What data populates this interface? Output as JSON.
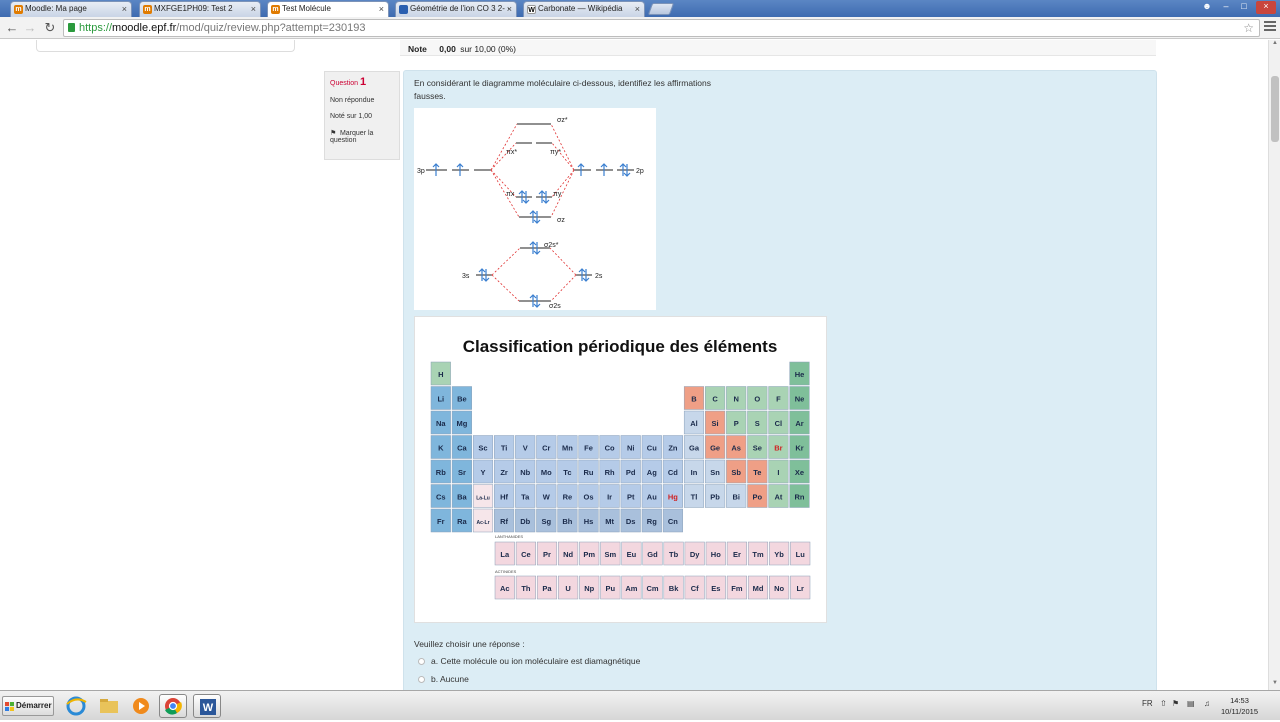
{
  "browser": {
    "tabs": [
      {
        "title": "Moodle: Ma page",
        "active": false
      },
      {
        "title": "MXFGE1PH09: Test 2",
        "active": false
      },
      {
        "title": "Test Molécule",
        "active": true
      },
      {
        "title": "Géométrie de l'ion CO 3 2- ·",
        "active": false
      },
      {
        "title": "Carbonate — Wikipédia",
        "active": false
      }
    ],
    "url": {
      "protocol": "https://",
      "host": "moodle.epf.fr",
      "path": "/mod/quiz/review.php?attempt=230193"
    }
  },
  "grade": {
    "label": "Note",
    "value": "0,00",
    "sur": "sur",
    "max": "10,00",
    "percent": "(0%)"
  },
  "question_info": {
    "label": "Question",
    "number": "1",
    "status": "Non répondue",
    "marks": "Noté sur 1,00",
    "flag_label": "Marquer la question"
  },
  "question": {
    "text": "En considérant le diagramme moléculaire ci-dessous, identifiez les affirmations fausses.",
    "choose_label": "Veuillez choisir une réponse :",
    "answers": [
      {
        "label": "a. Cette molécule ou ion moléculaire est diamagnétique"
      },
      {
        "label": "b. Aucune"
      }
    ]
  },
  "mo_diagram": {
    "left_top": "3p",
    "right_top": "2p",
    "left_bottom": "3s",
    "right_bottom": "2s",
    "sigma_z_star": "σz*",
    "pi_x_star": "πx*",
    "pi_y_star": "πy*",
    "pi_x": "πx",
    "pi_y": "πy",
    "sigma_z": "σz",
    "sigma_2s_star": "σ2s*",
    "sigma_2s": "σ2s"
  },
  "periodic_table": {
    "title": "Classification périodique des éléments",
    "rows": [
      [
        "H",
        "",
        "",
        "",
        "",
        "",
        "",
        "",
        "",
        "",
        "",
        "",
        "",
        "",
        "",
        "",
        "",
        "He"
      ],
      [
        "Li",
        "Be",
        "",
        "",
        "",
        "",
        "",
        "",
        "",
        "",
        "",
        "",
        "B",
        "C",
        "N",
        "O",
        "F",
        "Ne"
      ],
      [
        "Na",
        "Mg",
        "",
        "",
        "",
        "",
        "",
        "",
        "",
        "",
        "",
        "",
        "Al",
        "Si",
        "P",
        "S",
        "Cl",
        "Ar"
      ],
      [
        "K",
        "Ca",
        "Sc",
        "Ti",
        "V",
        "Cr",
        "Mn",
        "Fe",
        "Co",
        "Ni",
        "Cu",
        "Zn",
        "Ga",
        "Ge",
        "As",
        "Se",
        "Br",
        "Kr"
      ],
      [
        "Rb",
        "Sr",
        "Y",
        "Zr",
        "Nb",
        "Mo",
        "Tc",
        "Ru",
        "Rh",
        "Pd",
        "Ag",
        "Cd",
        "In",
        "Sn",
        "Sb",
        "Te",
        "I",
        "Xe"
      ],
      [
        "Cs",
        "Ba",
        "La-Lu",
        "Hf",
        "Ta",
        "W",
        "Re",
        "Os",
        "Ir",
        "Pt",
        "Au",
        "Hg",
        "Tl",
        "Pb",
        "Bi",
        "Po",
        "At",
        "Rn"
      ],
      [
        "Fr",
        "Ra",
        "Ac-Lr",
        "Rf",
        "Db",
        "Sg",
        "Bh",
        "Hs",
        "Mt",
        "Ds",
        "Rg",
        "Cn",
        "",
        "",
        "",
        "",
        "",
        ""
      ]
    ],
    "lanthanides_label": "LANTHANIDES",
    "lanthanides": [
      "La",
      "Ce",
      "Pr",
      "Nd",
      "Pm",
      "Sm",
      "Eu",
      "Gd",
      "Tb",
      "Dy",
      "Ho",
      "Er",
      "Tm",
      "Yb",
      "Lu"
    ],
    "actinides_label": "ACTINIDES",
    "actinides": [
      "Ac",
      "Th",
      "Pa",
      "U",
      "Np",
      "Pu",
      "Am",
      "Cm",
      "Bk",
      "Cf",
      "Es",
      "Fm",
      "Md",
      "No",
      "Lr"
    ]
  },
  "taskbar": {
    "start": "Démarrer",
    "lang": "FR",
    "time": "14:53",
    "date": "10/11/2015"
  },
  "colors": {
    "alkali": "#7fb6dc",
    "transition": "#b5cbe8",
    "metalloid": "#ef9f86",
    "nonmetal": "#a9d3b4",
    "noble": "#7fbf9a",
    "lanthanide": "#f3d7df",
    "quiz_bg": "#dcedf5"
  }
}
